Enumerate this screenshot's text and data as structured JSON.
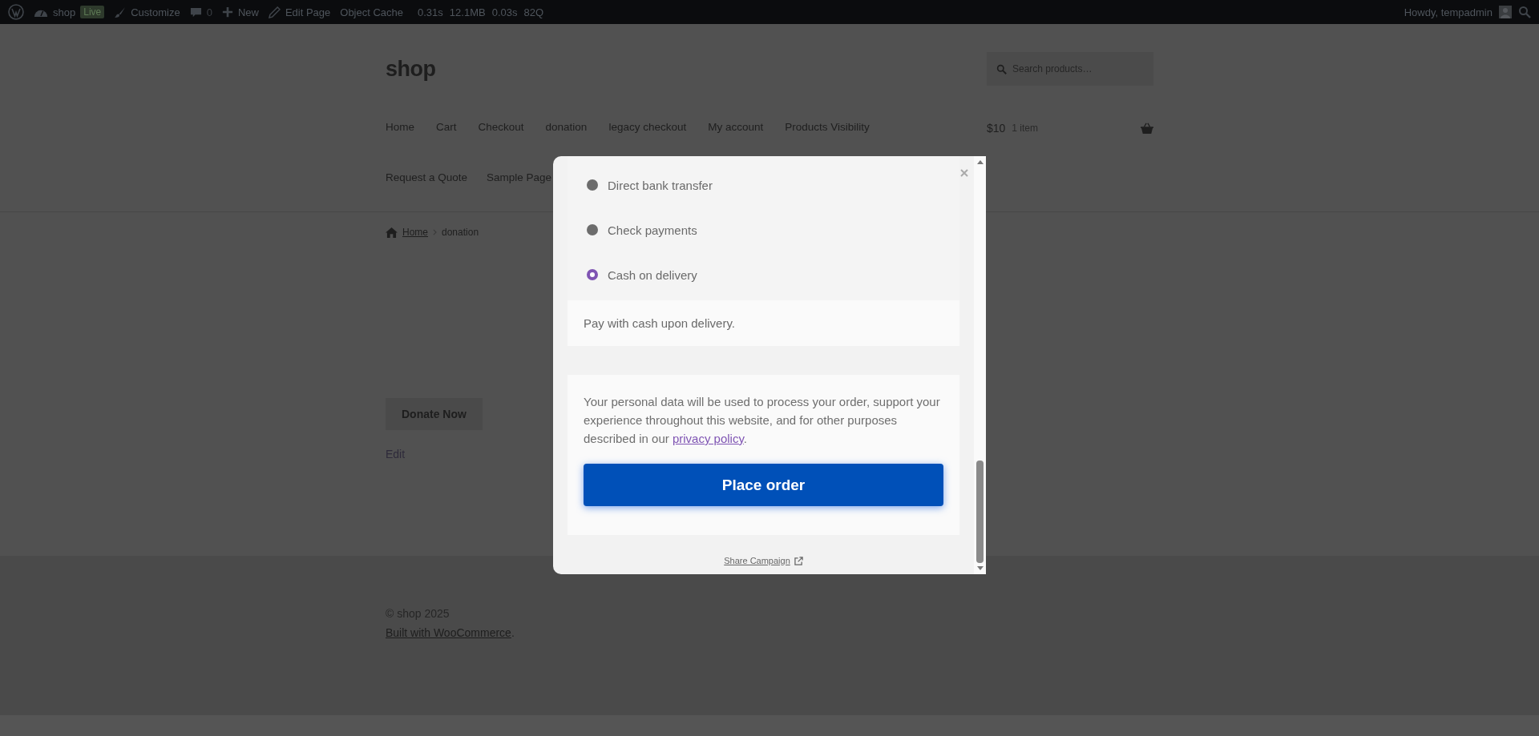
{
  "admin_bar": {
    "site": "shop",
    "badge": "Live",
    "items": [
      {
        "kind": "customize",
        "label": "Customize"
      },
      {
        "kind": "comments",
        "label": "0"
      },
      {
        "kind": "new",
        "label": "New"
      },
      {
        "kind": "edit",
        "label": "Edit Page"
      },
      {
        "kind": "plain",
        "label": "Object Cache"
      }
    ],
    "stats": [
      "0.31s",
      "12.1MB",
      "0.03s",
      "82Q"
    ],
    "greeting": "Howdy, tempadmin"
  },
  "header": {
    "site_title": "shop",
    "search": {
      "placeholder": "Search products…"
    },
    "nav_rows": [
      [
        "Home",
        "Cart",
        "Checkout",
        "donation",
        "legacy checkout",
        "My account",
        "Products Visibility"
      ],
      [
        "Request a Quote",
        "Sample Page"
      ]
    ],
    "cart": {
      "total": "$10",
      "count": "1 item"
    }
  },
  "breadcrumb": {
    "home": "Home",
    "current": "donation"
  },
  "donate_button": "Donate Now",
  "edit_link": "Edit",
  "modal": {
    "payment_methods": [
      {
        "label": "Direct bank transfer",
        "selected": false
      },
      {
        "label": "Check payments",
        "selected": false
      },
      {
        "label": "Cash on delivery",
        "selected": true
      }
    ],
    "payment_description": "Pay with cash upon delivery.",
    "privacy_text": "Your personal data will be used to process your order, support your experience throughout this website, and for other purposes described in our ",
    "privacy_link": "privacy policy",
    "privacy_suffix": ".",
    "place_order": "Place order",
    "share": "Share Campaign"
  },
  "footer": {
    "copyright": "© shop 2025",
    "credit_link": "Built with WooCommerce",
    "credit_suffix": "."
  }
}
